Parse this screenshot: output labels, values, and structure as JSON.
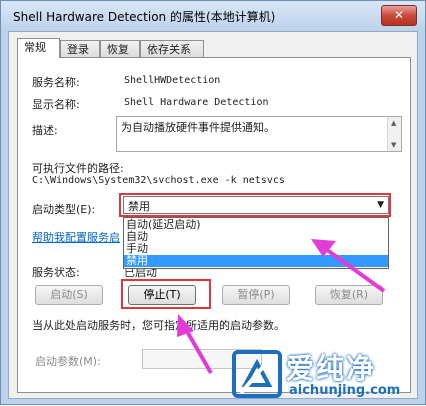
{
  "window": {
    "title": "Shell Hardware Detection 的属性(本地计算机)",
    "close_glyph": "✕"
  },
  "tabs": [
    {
      "label": "常规",
      "active": true
    },
    {
      "label": "登录"
    },
    {
      "label": "恢复"
    },
    {
      "label": "依存关系"
    }
  ],
  "general": {
    "service_name_label": "服务名称:",
    "service_name_value": "ShellHWDetection",
    "display_name_label": "显示名称:",
    "display_name_value": "Shell Hardware Detection",
    "description_label": "描述:",
    "description_value": "为自动播放硬件事件提供通知。",
    "exe_path_label": "可执行文件的路径:",
    "exe_path_value": "C:\\Windows\\System32\\svchost.exe -k netsvcs",
    "startup_type_label": "启动类型(E):",
    "startup_type_value": "禁用",
    "startup_options": [
      "自动(延迟启动)",
      "自动",
      "手动",
      "禁用"
    ],
    "help_link": "帮助我配置服务启",
    "status_label": "服务状态:",
    "status_value": "已启动",
    "buttons": {
      "start": "启动(S)",
      "stop": "停止(T)",
      "pause": "暂停(P)",
      "resume": "恢复(R)"
    },
    "hint_text": "当从此处启动服务时，您可指定所适用的启动参数。",
    "params_label": "启动参数(M):"
  },
  "watermark": {
    "brand": "爱纯净",
    "url": "aichunjing.com"
  },
  "colors": {
    "highlight_red": "#e0363e",
    "arrow_magenta": "#e23bd8",
    "selection_blue": "#3399ff"
  }
}
